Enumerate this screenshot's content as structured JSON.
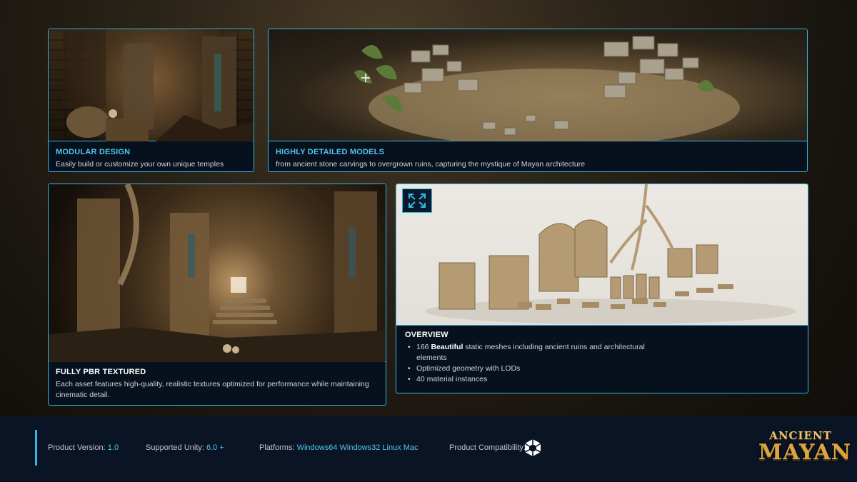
{
  "cards": [
    {
      "title": "MODULAR DESIGN",
      "description": "Easily build or customize your own unique temples"
    },
    {
      "title": "HIGHLY DETAILED MODELS",
      "description": "from ancient stone carvings to overgrown ruins, capturing the mystique of Mayan architecture"
    },
    {
      "title": "FULLY PBR TEXTURED",
      "description": "Each asset features high-quality, realistic textures optimized for performance while maintaining cinematic detail."
    }
  ],
  "overview": {
    "title": "OVERVIEW",
    "items": [
      {
        "prefix": "166 ",
        "bold": "Beautiful",
        "suffix": " static meshes including ancient ruins and architectural elements"
      },
      {
        "prefix": "Optimized geometry with LODs",
        "bold": "",
        "suffix": ""
      },
      {
        "prefix": "40  material instances",
        "bold": "",
        "suffix": ""
      }
    ],
    "expand_icon": "expand-icon"
  },
  "footer": {
    "product_version_label": "Product Version:",
    "product_version_value": "1.0",
    "supported_unity_label": "Supported Unity:",
    "supported_unity_value": "6.0 +",
    "platforms_label": "Platforms:",
    "platforms": [
      "Windows64",
      "Windows32",
      "Linux",
      "Mac"
    ],
    "compatibility_label": "Product Compatibility:",
    "compatibility_icon": "unity-icon"
  },
  "logo": {
    "line1": "ANCIENT",
    "line2": "MAYAN"
  },
  "colors": {
    "accent": "#35b7e3",
    "title": "#4fc6ef",
    "footer_bg": "#0b1424",
    "logo_gold": "#d9a441"
  }
}
